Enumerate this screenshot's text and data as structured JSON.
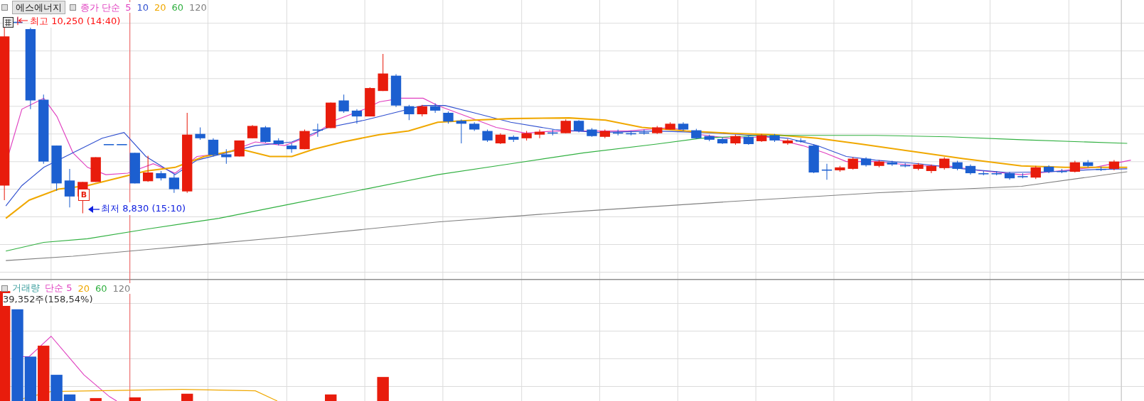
{
  "stock_name": "에스에너지",
  "price_legend": {
    "label": "종가 단순",
    "periods": [
      {
        "text": "5",
        "color": "#e040c0"
      },
      {
        "text": "10",
        "color": "#3050d0"
      },
      {
        "text": "20",
        "color": "#f0a800"
      },
      {
        "text": "60",
        "color": "#30b040"
      },
      {
        "text": "120",
        "color": "#808080"
      }
    ]
  },
  "high_marker": {
    "text": "최고 10,250 (14:40)"
  },
  "low_marker": {
    "text": "최저 8,830 (15:10)"
  },
  "buy_marker": {
    "text": "B"
  },
  "volume_legend": {
    "title": "거래량",
    "periods": [
      {
        "text": "단순 5",
        "color": "#e040c0"
      },
      {
        "text": "20",
        "color": "#f0a800"
      },
      {
        "text": "60",
        "color": "#30b040"
      },
      {
        "text": "120",
        "color": "#808080"
      }
    ]
  },
  "volume_reading": "39,352주(158,54%)"
}
